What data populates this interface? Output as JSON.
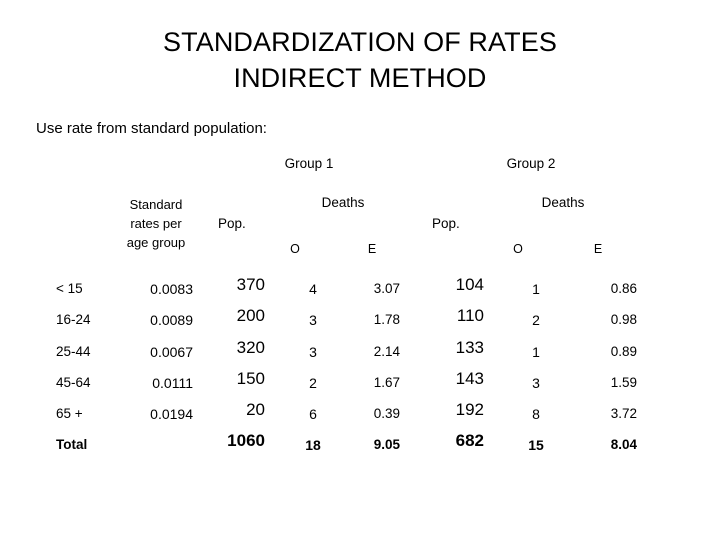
{
  "title": {
    "line1": "STANDARDIZATION OF RATES",
    "line2": "INDIRECT METHOD"
  },
  "intro": "Use rate from standard population:",
  "table": {
    "group_headers": [
      {
        "label": "Group 1"
      },
      {
        "label": "Group 2"
      }
    ],
    "stub_header": {
      "line1": "Standard",
      "line2": "rates per",
      "line3": "age group"
    },
    "sub_headers": {
      "deaths_1": "Deaths",
      "deaths_2": "Deaths",
      "pop_1": "Pop.",
      "pop_2": "Pop.",
      "observed_1": "O",
      "expected_1": "E",
      "observed_2": "O",
      "expected_2": "E"
    },
    "rows": [
      {
        "age_group": "< 15",
        "standard_rate": "0.0083",
        "g1_pop": "370",
        "g1_observed": "4",
        "g1_expected": "3.07",
        "g2_pop": "104",
        "g2_observed": "1",
        "g2_expected": "0.86"
      },
      {
        "age_group": "16-24",
        "standard_rate": "0.0089",
        "g1_pop": "200",
        "g1_observed": "3",
        "g1_expected": "1.78",
        "g2_pop": "110",
        "g2_observed": "2",
        "g2_expected": "0.98"
      },
      {
        "age_group": "25-44",
        "standard_rate": "0.0067",
        "g1_pop": "320",
        "g1_observed": "3",
        "g1_expected": "2.14",
        "g2_pop": "133",
        "g2_observed": "1",
        "g2_expected": "0.89"
      },
      {
        "age_group": "45-64",
        "standard_rate": "0.0111",
        "g1_pop": "150",
        "g1_observed": "2",
        "g1_expected": "1.67",
        "g2_pop": "143",
        "g2_observed": "3",
        "g2_expected": "1.59"
      },
      {
        "age_group": "65 +",
        "standard_rate": "0.0194",
        "g1_pop": "20",
        "g1_observed": "6",
        "g1_expected": "0.39",
        "g2_pop": "192",
        "g2_observed": "8",
        "g2_expected": "3.72"
      }
    ],
    "total_row": {
      "age_group": "Total",
      "standard_rate": "",
      "g1_pop": "1060",
      "g1_observed": "18",
      "g1_expected": "9.05",
      "g2_pop": "682",
      "g2_observed": "15",
      "g2_expected": "8.04"
    }
  }
}
